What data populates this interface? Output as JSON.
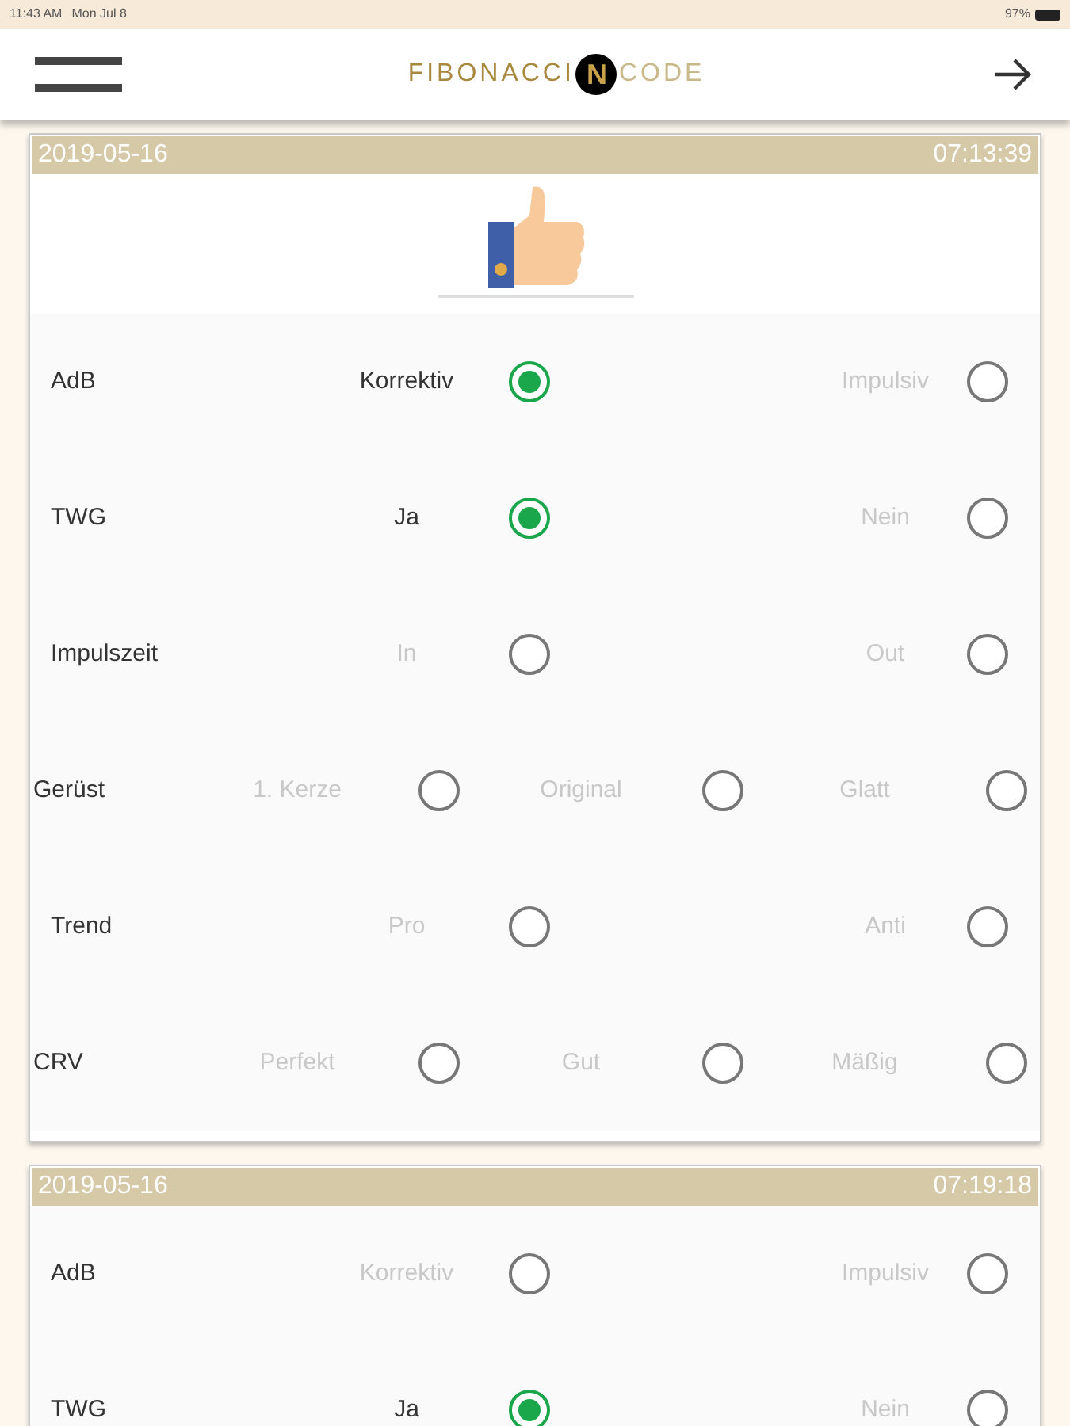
{
  "status_bar": {
    "time": "11:43 AM",
    "date": "Mon Jul 8",
    "battery": "97%"
  },
  "header": {
    "logo": {
      "left": "FIBONACCI",
      "mark": "N",
      "right": "CODE"
    }
  },
  "entries": [
    {
      "date": "2019-05-16",
      "time": "07:13:39",
      "rated": true,
      "criteria": [
        {
          "label": "AdB",
          "options": [
            {
              "label": "Korrektiv",
              "selected": true
            },
            {
              "label": "Impulsiv",
              "selected": false
            }
          ]
        },
        {
          "label": "TWG",
          "options": [
            {
              "label": "Ja",
              "selected": true
            },
            {
              "label": "Nein",
              "selected": false
            }
          ]
        },
        {
          "label": "Impulszeit",
          "options": [
            {
              "label": "In",
              "selected": false
            },
            {
              "label": "Out",
              "selected": false
            }
          ]
        },
        {
          "label": "Gerüst",
          "options": [
            {
              "label": "1. Kerze",
              "selected": false
            },
            {
              "label": "Original",
              "selected": false
            },
            {
              "label": "Glatt",
              "selected": false
            }
          ]
        },
        {
          "label": "Trend",
          "options": [
            {
              "label": "Pro",
              "selected": false
            },
            {
              "label": "Anti",
              "selected": false
            }
          ]
        },
        {
          "label": "CRV",
          "options": [
            {
              "label": "Perfekt",
              "selected": false
            },
            {
              "label": "Gut",
              "selected": false
            },
            {
              "label": "Mäßig",
              "selected": false
            }
          ]
        }
      ]
    },
    {
      "date": "2019-05-16",
      "time": "07:19:18",
      "rated": false,
      "criteria": [
        {
          "label": "AdB",
          "options": [
            {
              "label": "Korrektiv",
              "selected": false
            },
            {
              "label": "Impulsiv",
              "selected": false
            }
          ]
        },
        {
          "label": "TWG",
          "options": [
            {
              "label": "Ja",
              "selected": true
            },
            {
              "label": "Nein",
              "selected": false
            }
          ]
        }
      ]
    }
  ]
}
